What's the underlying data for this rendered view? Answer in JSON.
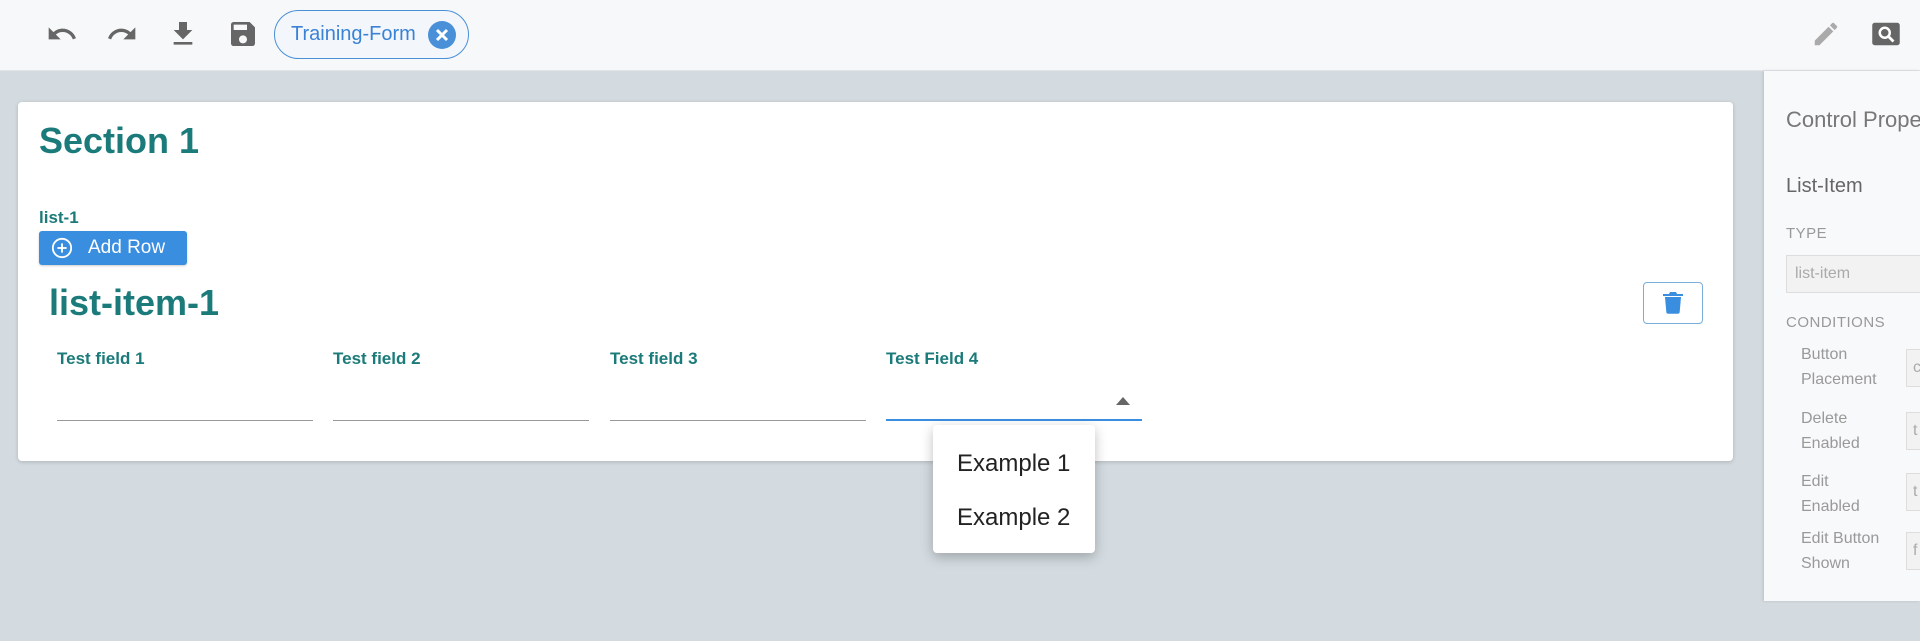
{
  "toolbar": {
    "undo_icon": "undo-icon",
    "redo_icon": "redo-icon",
    "download_icon": "download-icon",
    "save_icon": "save-icon",
    "form_chip_label": "Training-Form",
    "edit_icon": "pencil-icon",
    "search_icon": "search-icon"
  },
  "section": {
    "title": "Section 1",
    "list_label": "list-1",
    "add_row_label": "Add Row",
    "list_item_title": "list-item-1",
    "fields": [
      {
        "label": "Test field 1",
        "value": ""
      },
      {
        "label": "Test field 2",
        "value": ""
      },
      {
        "label": "Test field 3",
        "value": ""
      },
      {
        "label": "Test Field 4",
        "value": ""
      }
    ]
  },
  "dropdown": {
    "options": [
      "Example 1",
      "Example 2"
    ]
  },
  "panel": {
    "title": "Control Prope",
    "subtitle": "List-Item",
    "type_caption": "TYPE",
    "type_value": "list-item",
    "conditions_caption": "CONDITIONS",
    "props": [
      {
        "label": "Button Placement",
        "value": "c"
      },
      {
        "label": "Delete Enabled",
        "value": "t"
      },
      {
        "label": "Edit Enabled",
        "value": "t"
      },
      {
        "label": "Edit Button Shown",
        "value": "f"
      }
    ]
  },
  "colors": {
    "accent": "#3a8ee0",
    "heading": "#1b7a7a",
    "background": "#d3dbe0"
  }
}
